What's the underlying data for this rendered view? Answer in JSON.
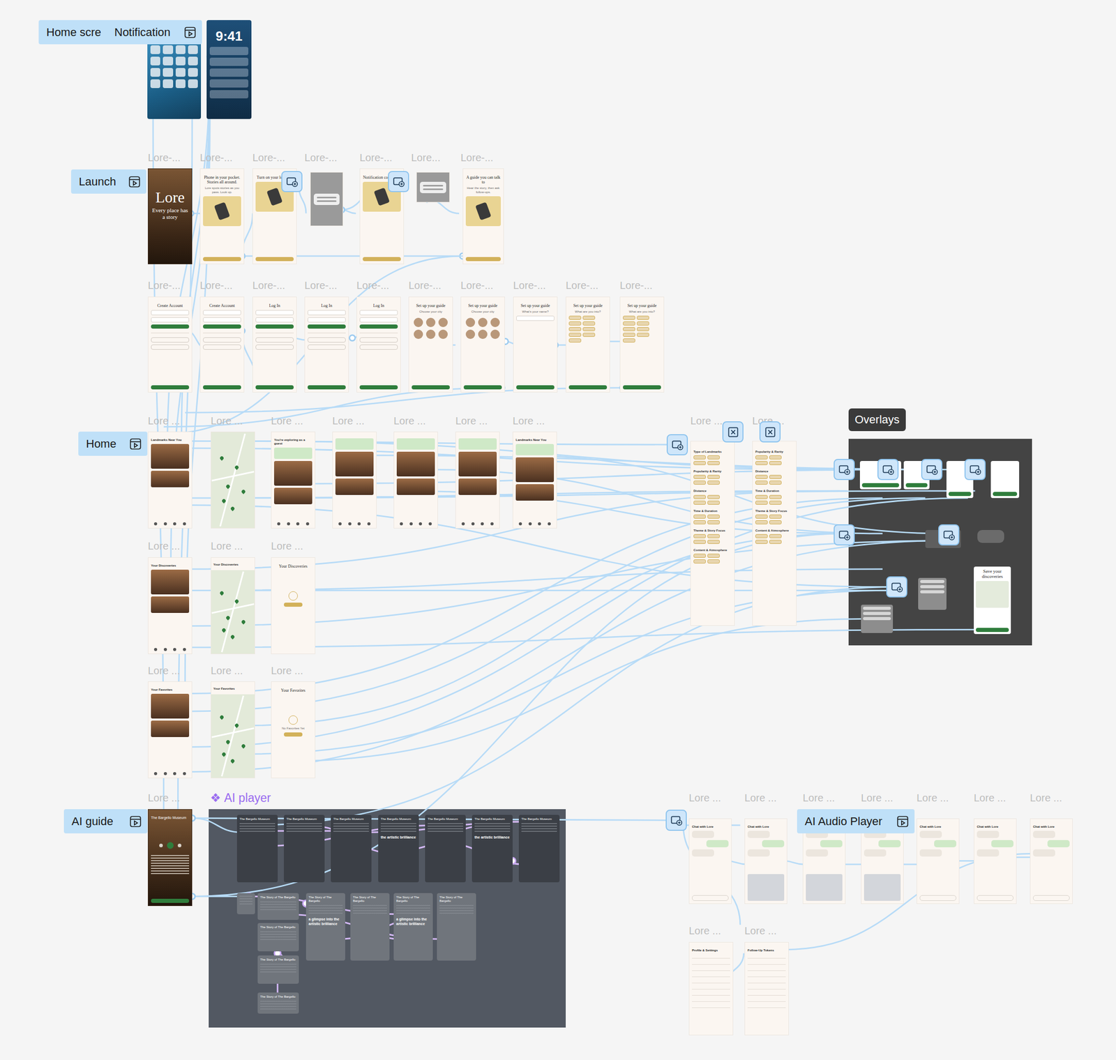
{
  "flow_starts": [
    {
      "label": "Home scre",
      "icon": false
    },
    {
      "label": "Notification",
      "icon": true
    },
    {
      "label": "Launch",
      "icon": true
    },
    {
      "label": "Home",
      "icon": true
    },
    {
      "label": "AI guide",
      "icon": true
    },
    {
      "label": "AI Audio Player",
      "icon": true
    }
  ],
  "sections": [
    {
      "title": "Overlays",
      "kind": "overlays"
    },
    {
      "title": "AI player",
      "icon": "❖",
      "kind": "component"
    }
  ],
  "device_screens": [
    {
      "kind": "home",
      "time": ""
    },
    {
      "kind": "lock",
      "time": "9:41"
    }
  ],
  "frames": [
    {
      "label": "Lore-...",
      "kind": "photo",
      "heading": "Lore",
      "sub": "Every place has a story",
      "color": "#d2b15a"
    },
    {
      "label": "Lore-...",
      "kind": "intro",
      "heading": "Phone in your pocket. Stories all around.",
      "sub": "Lore spots stories as you pass. Look up.",
      "color": "#d2b15a"
    },
    {
      "label": "Lore-...",
      "kind": "intro",
      "heading": "Turn on your location",
      "color": "#d2b15a"
    },
    {
      "label": "Lore-...",
      "kind": "dialog"
    },
    {
      "label": "Lore-...",
      "kind": "intro",
      "heading": "Notification cool spots",
      "color": "#d2b15a"
    },
    {
      "label": "Lore...",
      "kind": "dialog"
    },
    {
      "label": "Lore-...",
      "kind": "intro",
      "heading": "A guide you can talk to",
      "sub": "Hear the story, then ask follow-ups.",
      "color": "#d2b15a"
    },
    {
      "label": "Lore-...",
      "kind": "form",
      "heading": "Create Account",
      "color": "#2f7d3c"
    },
    {
      "label": "Lore-...",
      "kind": "form",
      "heading": "Create Account",
      "color": "#2f7d3c"
    },
    {
      "label": "Lore-...",
      "kind": "form",
      "heading": "Log In",
      "color": "#2f7d3c"
    },
    {
      "label": "Lore-...",
      "kind": "form",
      "heading": "Log In",
      "color": "#2f7d3c"
    },
    {
      "label": "Lore-...",
      "kind": "form",
      "heading": "Log In",
      "color": "#2f7d3c"
    },
    {
      "label": "Lore-...",
      "kind": "avatars",
      "heading": "Set up your guide",
      "sub": "Choose your city",
      "color": "#2f7d3c"
    },
    {
      "label": "Lore-...",
      "kind": "avatars",
      "heading": "Set up your guide",
      "sub": "Choose your city",
      "color": "#2f7d3c"
    },
    {
      "label": "Lore-...",
      "kind": "name",
      "heading": "Set up your guide",
      "sub": "What's your name?",
      "color": "#2f7d3c"
    },
    {
      "label": "Lore-...",
      "kind": "tags",
      "heading": "Set up your guide",
      "sub": "What are you into?",
      "color": "#2f7d3c"
    },
    {
      "label": "Lore-...",
      "kind": "tags",
      "heading": "Set up your guide",
      "sub": "What are you into?",
      "color": "#2f7d3c"
    },
    {
      "label": "Lore ...",
      "kind": "list",
      "heading": "Landmarks Near You",
      "banner": false
    },
    {
      "label": "Lore ...",
      "kind": "map"
    },
    {
      "label": "Lore ...",
      "kind": "list",
      "heading": "You're exploring as a guest",
      "banner": true
    },
    {
      "label": "Lore ...",
      "kind": "list",
      "banner": true
    },
    {
      "label": "Lore ...",
      "kind": "list",
      "banner": true
    },
    {
      "label": "Lore ...",
      "kind": "list",
      "banner": true
    },
    {
      "label": "Lore ...",
      "kind": "list",
      "heading": "Landmarks Near You",
      "banner": true
    },
    {
      "label": "Lore ...",
      "kind": "filter",
      "groups": [
        "Type of Landmarks",
        "Popularity & Rarity",
        "Distance",
        "Time & Duration",
        "Theme & Story Focus",
        "Content & Atmosphere"
      ]
    },
    {
      "label": "Lore ...",
      "kind": "filter",
      "groups": [
        "Popularity & Rarity",
        "Distance",
        "Time & Duration",
        "Theme & Story Focus",
        "Content & Atmosphere"
      ]
    },
    {
      "label": "Lore ...",
      "kind": "list",
      "heading": "Your Discoveries",
      "banner": false
    },
    {
      "label": "Lore ...",
      "kind": "map",
      "heading": "Your Discoveries"
    },
    {
      "label": "Lore ...",
      "kind": "empty",
      "heading": "Your Discoveries",
      "color": "#d2b15a"
    },
    {
      "label": "Lore ...",
      "kind": "list",
      "heading": "Your Favorites",
      "banner": false
    },
    {
      "label": "Lore ...",
      "kind": "map",
      "heading": "Your Favorites"
    },
    {
      "label": "Lore ...",
      "kind": "empty",
      "heading": "Your Favorites",
      "sub": "No Favorites Yet",
      "color": "#d2b15a"
    },
    {
      "label": "Lore ...",
      "kind": "player",
      "heading": "The Bargello Museum",
      "color": "#2f7d3c"
    },
    {
      "label": "Lore ...",
      "kind": "chat",
      "heading": "Chat with Lore",
      "keyboard": false
    },
    {
      "label": "Lore ...",
      "kind": "chat",
      "heading": "Chat with Lore",
      "keyboard": true
    },
    {
      "label": "Lore ...",
      "kind": "chat",
      "heading": "Chat with Lore",
      "keyboard": true
    },
    {
      "label": "Lore ...",
      "kind": "chat",
      "heading": "Chat with Lore",
      "keyboard": true
    },
    {
      "label": "Lore ...",
      "kind": "chat",
      "heading": "Chat with Lore",
      "keyboard": false
    },
    {
      "label": "Lore ...",
      "kind": "chat",
      "heading": "Chat with Lore",
      "keyboard": false
    },
    {
      "label": "Lore ...",
      "kind": "chat",
      "heading": "Chat with Lore",
      "keyboard": false
    },
    {
      "label": "Lore ...",
      "kind": "settings",
      "heading": "Profile & Settings"
    },
    {
      "label": "Lore ...",
      "kind": "settings",
      "heading": "Follow-Up Tokens"
    }
  ],
  "overlay_cards": [
    {
      "kind": "card"
    },
    {
      "kind": "card"
    },
    {
      "kind": "card"
    },
    {
      "kind": "card"
    },
    {
      "kind": "dark"
    },
    {
      "kind": "pill"
    },
    {
      "kind": "menu"
    },
    {
      "kind": "menu"
    },
    {
      "kind": "sheet",
      "title": "Save your discoveries"
    }
  ],
  "player_cards": [
    {
      "kind": "dark",
      "title": "The Bargello Museum"
    },
    {
      "kind": "dark",
      "title": "The Bargello Museum"
    },
    {
      "kind": "dark",
      "title": "The Bargello Museum"
    },
    {
      "kind": "dark",
      "title": "The Bargello Museum",
      "excerpt": "the artistic brilliance"
    },
    {
      "kind": "dark",
      "title": "The Bargello Museum"
    },
    {
      "kind": "dark",
      "title": "The Bargello Museum",
      "excerpt": "the artistic brilliance"
    },
    {
      "kind": "dark",
      "title": "The Bargello Museum"
    },
    {
      "kind": "light",
      "title": "The Story of The Bargello"
    },
    {
      "kind": "light",
      "title": "The Story of The Bargello"
    },
    {
      "kind": "light",
      "title": "The Story of The Bargello"
    },
    {
      "kind": "light",
      "title": "The Story of The Bargello"
    },
    {
      "kind": "light",
      "title": "The Story of The Bargello",
      "excerpt": "a glimpse into the artistic brilliance"
    },
    {
      "kind": "light",
      "title": "The Story of The Bargello"
    },
    {
      "kind": "light",
      "title": "The Story of The Bargello",
      "excerpt": "a glimpse into the artistic brilliance"
    },
    {
      "kind": "light",
      "title": "The Story of The Bargello"
    },
    {
      "kind": "light"
    }
  ]
}
